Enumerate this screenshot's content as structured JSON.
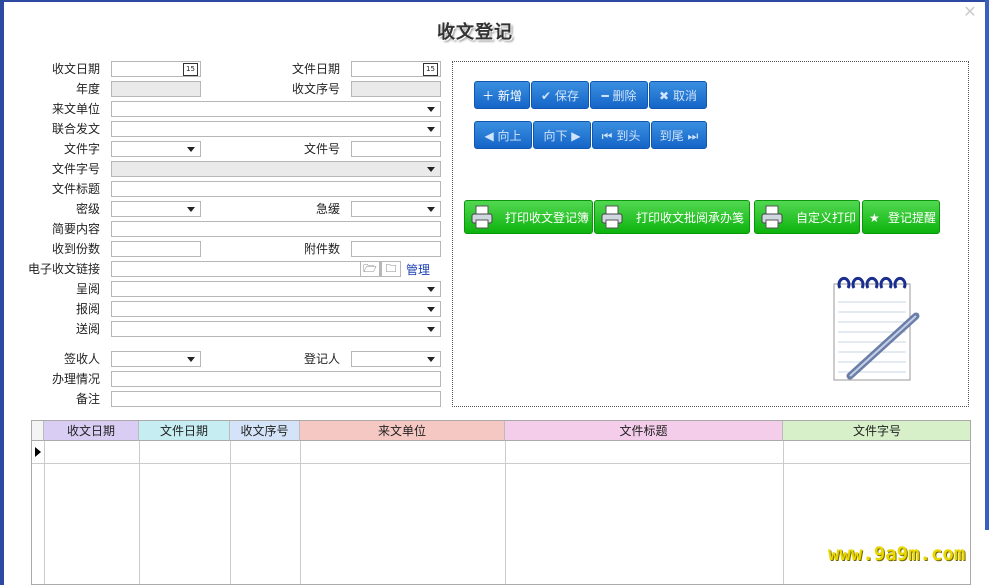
{
  "title": "收文登记",
  "close_icon": "close-icon",
  "form": {
    "recv_date": "收文日期",
    "file_date": "文件日期",
    "year": "年度",
    "recv_seq": "收文序号",
    "from_unit": "来文单位",
    "joint_issue": "联合发文",
    "doc_char": "文件字",
    "doc_num": "文件号",
    "doc_char_num": "文件字号",
    "doc_title": "文件标题",
    "secret_level": "密级",
    "urgency": "急缓",
    "summary": "简要内容",
    "copies": "收到份数",
    "attachments": "附件数",
    "e_link": "电子收文链接",
    "manage": "管理",
    "submit_read": "呈阅",
    "report_read": "报阅",
    "send_read": "送阅",
    "receiver": "签收人",
    "registrar": "登记人",
    "handling": "办理情况",
    "remarks": "备注"
  },
  "buttons": {
    "add": "新增",
    "save": "保存",
    "delete": "删除",
    "cancel": "取消",
    "up": "向上",
    "down": "向下",
    "first": "到头",
    "last": "到尾",
    "print_register": "打印收文登记簿",
    "print_approval": "打印收文批阅承办笺",
    "custom_print": "自定义打印",
    "reminder": "登记提醒"
  },
  "grid": {
    "columns": [
      "收文日期",
      "文件日期",
      "收文序号",
      "来文单位",
      "文件标题",
      "文件字号"
    ],
    "colors": [
      "#d9cdf3",
      "#c6eef2",
      "#d4e3f7",
      "#f5c8c4",
      "#f3cdea",
      "#d7f0c9"
    ]
  },
  "watermark": "www.9a9m.com"
}
